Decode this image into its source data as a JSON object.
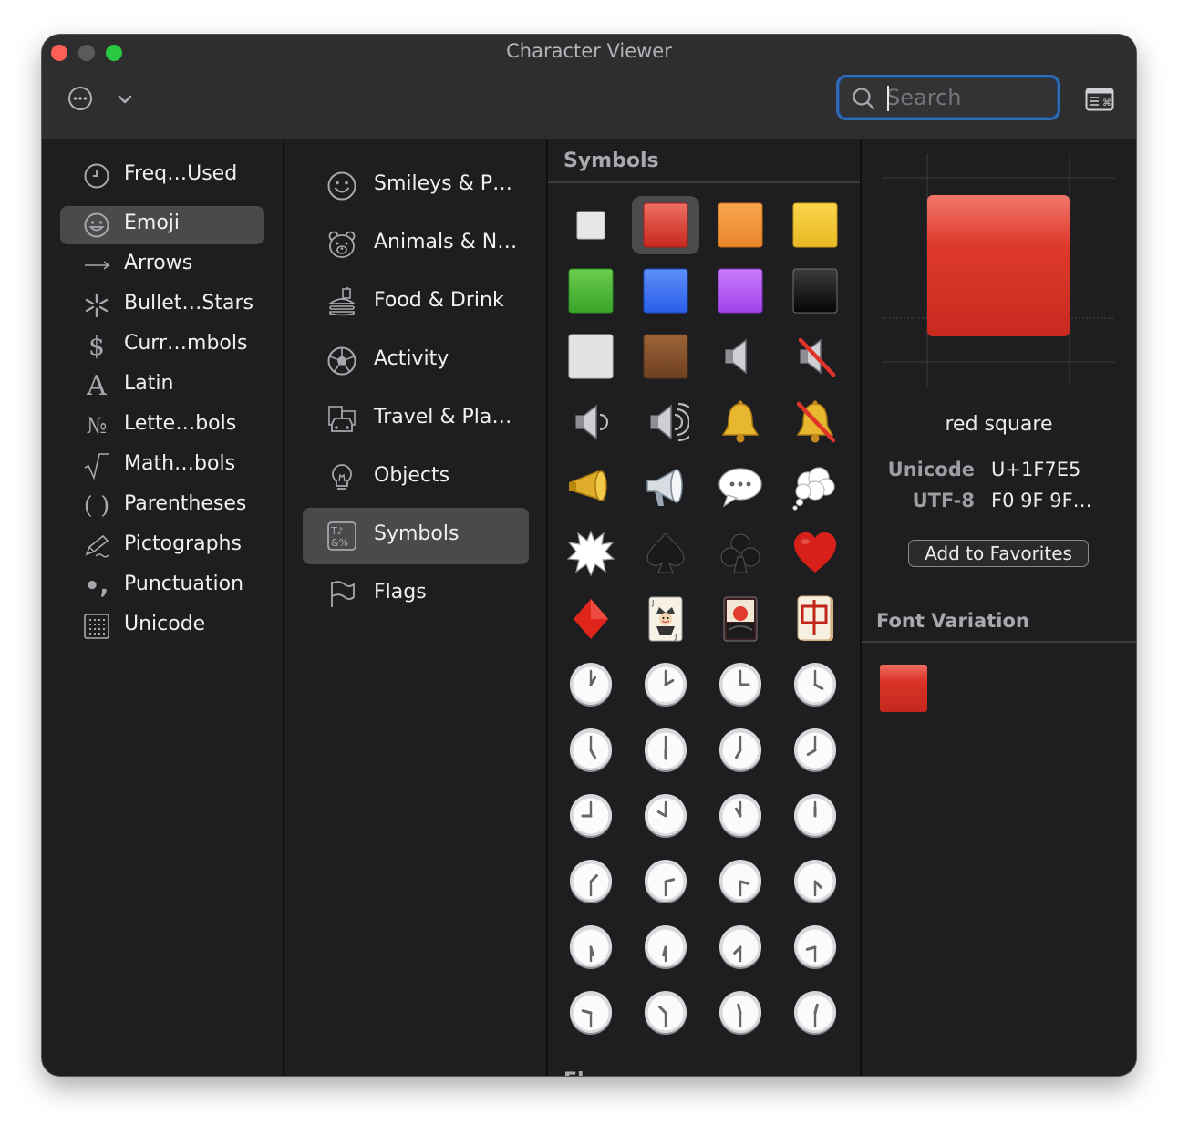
{
  "window": {
    "title": "Character Viewer"
  },
  "toolbar": {
    "search_placeholder": "Search"
  },
  "sidebar": {
    "items": [
      {
        "label": "Freq…Used",
        "icon": "clock-icon"
      },
      {
        "label": "Emoji",
        "icon": "smiley-icon",
        "selected": true
      },
      {
        "label": "Arrows",
        "icon": "arrow-right-icon"
      },
      {
        "label": "Bullet…Stars",
        "icon": "asterisk-icon"
      },
      {
        "label": "Curr…mbols",
        "icon": "dollar-icon"
      },
      {
        "label": "Latin",
        "icon": "latin-a-icon"
      },
      {
        "label": "Lette…bols",
        "icon": "numero-icon"
      },
      {
        "label": "Math…bols",
        "icon": "square-root-icon"
      },
      {
        "label": "Parentheses",
        "icon": "parentheses-icon"
      },
      {
        "label": "Pictographs",
        "icon": "pencil-icon"
      },
      {
        "label": "Punctuation",
        "icon": "punctuation-icon"
      },
      {
        "label": "Unicode",
        "icon": "grid-icon"
      }
    ]
  },
  "subcategories": [
    {
      "label": "Smileys & P…",
      "icon": "smiley-icon"
    },
    {
      "label": "Animals & N…",
      "icon": "bear-icon"
    },
    {
      "label": "Food & Drink",
      "icon": "burger-icon"
    },
    {
      "label": "Activity",
      "icon": "soccer-ball-icon"
    },
    {
      "label": "Travel & Pla…",
      "icon": "car-building-icon"
    },
    {
      "label": "Objects",
      "icon": "lightbulb-icon"
    },
    {
      "label": "Symbols",
      "icon": "symbols-icon",
      "selected": true
    },
    {
      "label": "Flags",
      "icon": "flag-icon"
    }
  ],
  "symbols": {
    "title": "Symbols",
    "next_section_partial": "Fl",
    "selected_index": 1,
    "items": [
      "white-square",
      "red-square",
      "orange-square",
      "yellow-square",
      "green-square",
      "blue-square",
      "purple-square",
      "black-square",
      "white-large-square",
      "brown-square",
      "speaker",
      "muted-speaker",
      "speaker-low",
      "speaker-high",
      "bell",
      "bell-slash",
      "megaphone",
      "loudspeaker",
      "speech-balloon",
      "thought-balloon",
      "anger-bubble",
      "spade",
      "club",
      "heart",
      "diamond",
      "joker",
      "flower-card",
      "mahjong-red-dragon",
      "clock-1",
      "clock-2",
      "clock-3",
      "clock-4",
      "clock-5",
      "clock-6",
      "clock-7",
      "clock-8",
      "clock-9",
      "clock-10",
      "clock-11",
      "clock-12",
      "clock-130",
      "clock-230",
      "clock-330",
      "clock-430",
      "clock-530",
      "clock-630",
      "clock-730",
      "clock-830",
      "clock-930",
      "clock-1030",
      "clock-1130",
      "clock-1230"
    ]
  },
  "detail": {
    "name": "red square",
    "unicode_label": "Unicode",
    "unicode_value": "U+1F7E5",
    "utf8_label": "UTF-8",
    "utf8_value": "F0 9F 9F…",
    "favorites_button": "Add to Favorites",
    "font_variation_title": "Font Variation"
  },
  "colors": {
    "accent": "#2f6ab2",
    "window_bg": "#1e1e20",
    "selection": "#4a4a4c"
  }
}
